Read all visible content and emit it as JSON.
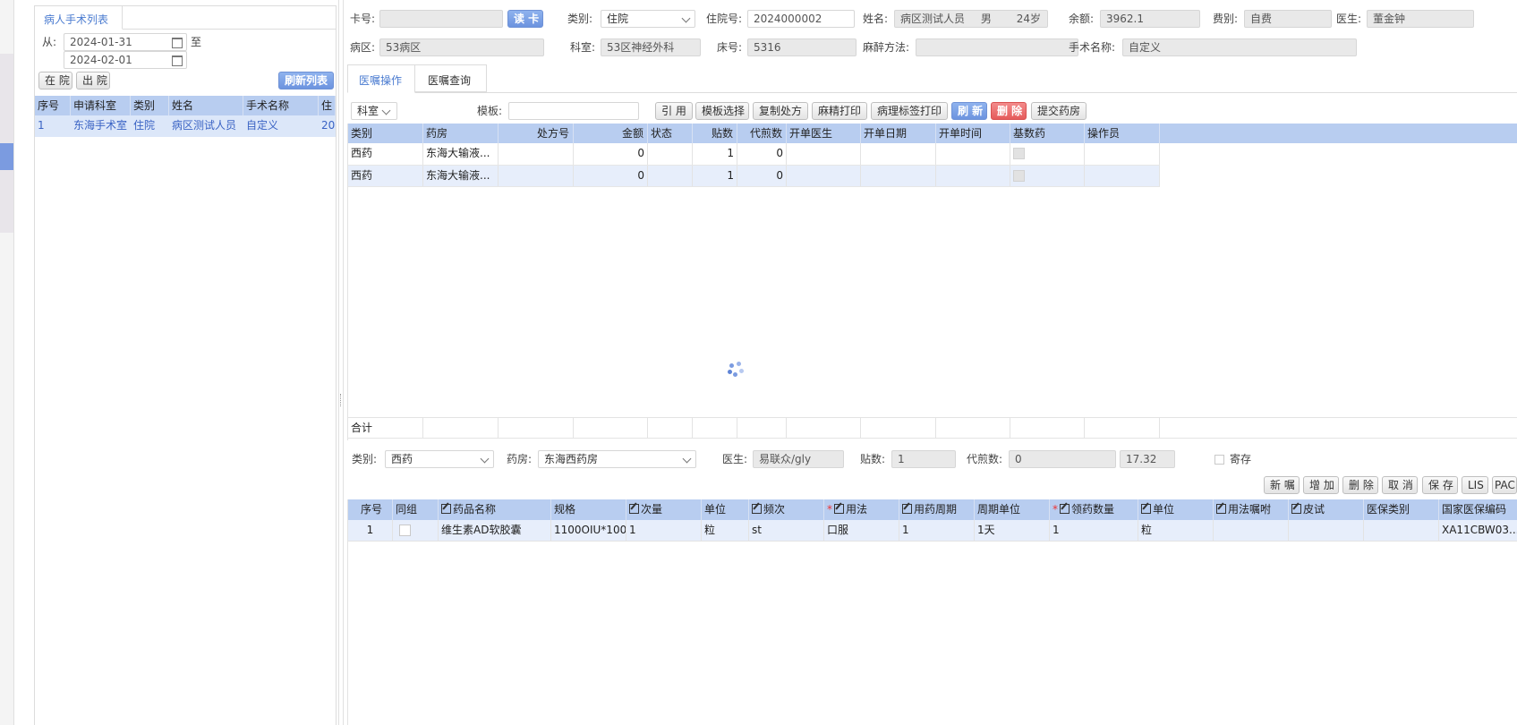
{
  "left_panel": {
    "tab_label": "病人手术列表",
    "from_label": "从:",
    "to_label": "至",
    "date_from": "2024-01-31",
    "date_to": "2024-02-01",
    "btn_in": "在 院",
    "btn_out": "出 院",
    "btn_refresh": "刷新列表",
    "columns": [
      "序号",
      "申请科室",
      "类别",
      "姓名",
      "手术名称",
      "住"
    ],
    "rows": [
      [
        "1",
        "东海手术室",
        "住院",
        "病区测试人员",
        "自定义",
        "20"
      ]
    ]
  },
  "header": {
    "card_label": "卡号:",
    "card_value": "",
    "read_card_btn": "读 卡",
    "type_label": "类别:",
    "type_value": "住院",
    "inpatient_no_label": "住院号:",
    "inpatient_no_value": "2024000002",
    "name_label": "姓名:",
    "name_value": "病区测试人员",
    "gender_value": "男",
    "age_value": "24岁",
    "balance_label": "余额:",
    "balance_value": "3962.1",
    "fee_type_label": "费别:",
    "fee_type_value": "自费",
    "doctor_label": "医生:",
    "doctor_value": "董金钟",
    "ward_label": "病区:",
    "ward_value": "53病区",
    "dept_label": "科室:",
    "dept_value": "53区神经外科",
    "bed_label": "床号:",
    "bed_value": "5316",
    "anesthesia_label": "麻醉方法:",
    "anesthesia_value": "",
    "surgery_label": "手术名称:",
    "surgery_value": "自定义"
  },
  "tabs": [
    "医嘱操作",
    "医嘱查询"
  ],
  "toolbar": {
    "dept_select": "科室",
    "template_label": "模板:",
    "template_value": "",
    "buttons": [
      "引 用",
      "模板选择",
      "复制处方",
      "麻精打印",
      "病理标签打印"
    ],
    "refresh_btn": "刷 新",
    "delete_btn": "删 除",
    "submit_btn": "提交药房"
  },
  "rx_table": {
    "columns": [
      "类别",
      "药房",
      "处方号",
      "金额",
      "状态",
      "贴数",
      "代煎数",
      "开单医生",
      "开单日期",
      "开单时间",
      "基数药",
      "操作员"
    ],
    "rows": [
      [
        "西药",
        "东海大输液...",
        "",
        "0",
        "",
        "1",
        "0",
        "",
        "",
        "",
        "",
        ""
      ],
      [
        "西药",
        "东海大输液...",
        "",
        "0",
        "",
        "1",
        "0",
        "",
        "",
        "",
        "",
        ""
      ]
    ],
    "total_label": "合计"
  },
  "detail_form": {
    "type_label": "类别:",
    "type_value": "西药",
    "pharmacy_label": "药房:",
    "pharmacy_value": "东海西药房",
    "doctor_label": "医生:",
    "doctor_value": "易联众/gly",
    "doses_label": "贴数:",
    "doses_value": "1",
    "decoct_label": "代煎数:",
    "decoct_value": "0",
    "amount_value": "17.32",
    "deposit_label": "寄存"
  },
  "detail_buttons": [
    "新 嘱",
    "增 加",
    "删 除",
    "取 消",
    "保 存",
    "LIS",
    "PAC"
  ],
  "detail_table": {
    "columns": [
      "序号",
      "同组",
      "药品名称",
      "规格",
      "次量",
      "单位",
      "频次",
      "用法",
      "用药周期",
      "周期单位",
      "领药数量",
      "单位",
      "用法嘱咐",
      "皮试",
      "医保类别",
      "国家医保编码"
    ],
    "rows": [
      [
        "1",
        "",
        "维生素AD软胶囊",
        "1100OIU*100...",
        "1",
        "粒",
        "st",
        "口服",
        "1",
        "1天",
        "1",
        "粒",
        "",
        "",
        "",
        "XA11CBW03..."
      ]
    ]
  }
}
